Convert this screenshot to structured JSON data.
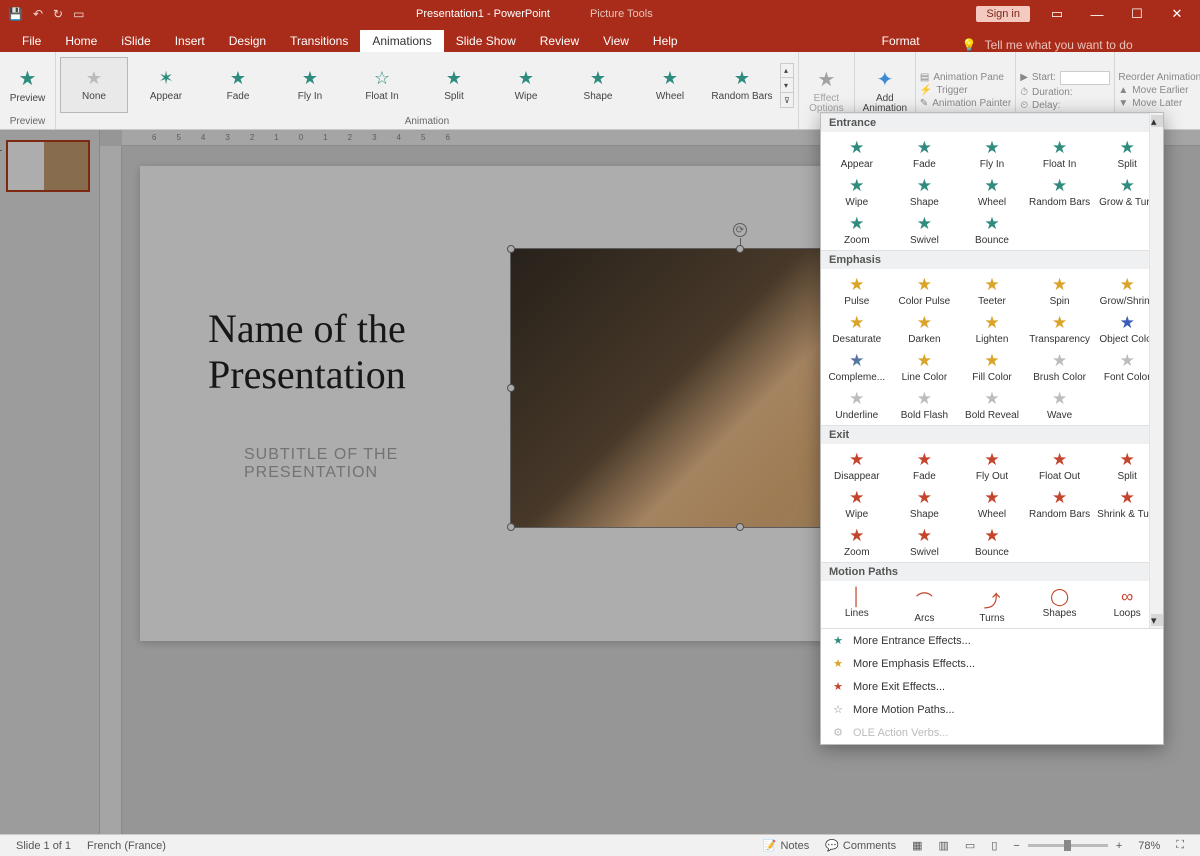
{
  "app": {
    "title": "Presentation1 - PowerPoint",
    "contextual_tool": "Picture Tools",
    "sign_in": "Sign in"
  },
  "qat": [
    "save",
    "undo",
    "redo",
    "slideshow"
  ],
  "tabs": {
    "items": [
      "File",
      "Home",
      "iSlide",
      "Insert",
      "Design",
      "Transitions",
      "Animations",
      "Slide Show",
      "Review",
      "View",
      "Help"
    ],
    "active": "Animations",
    "context": "Format",
    "tellme": "Tell me what you want to do"
  },
  "ribbon": {
    "preview": {
      "label": "Preview",
      "group": "Preview"
    },
    "animation_group": "Animation",
    "gallery": [
      "None",
      "Appear",
      "Fade",
      "Fly In",
      "Float In",
      "Split",
      "Wipe",
      "Shape",
      "Wheel",
      "Random Bars"
    ],
    "effect_options": "Effect Options",
    "add_animation": "Add Animation",
    "advanced": {
      "pane": "Animation Pane",
      "trigger": "Trigger",
      "painter": "Animation Painter"
    },
    "timing": {
      "start": "Start:",
      "duration": "Duration:",
      "delay": "Delay:"
    },
    "reorder": {
      "label": "Reorder Animation",
      "earlier": "Move Earlier",
      "later": "Move Later"
    }
  },
  "slide": {
    "title": "Name of the\nPresentation",
    "subtitle": "SUBTITLE OF THE PRESENTATION"
  },
  "dropdown": {
    "sections": {
      "entrance": {
        "label": "Entrance",
        "items": [
          "Appear",
          "Fade",
          "Fly In",
          "Float In",
          "Split",
          "Wipe",
          "Shape",
          "Wheel",
          "Random Bars",
          "Grow & Turn",
          "Zoom",
          "Swivel",
          "Bounce"
        ]
      },
      "emphasis": {
        "label": "Emphasis",
        "items": [
          "Pulse",
          "Color Pulse",
          "Teeter",
          "Spin",
          "Grow/Shrink",
          "Desaturate",
          "Darken",
          "Lighten",
          "Transparency",
          "Object Color",
          "Compleme...",
          "Line Color",
          "Fill Color",
          "Brush Color",
          "Font Color",
          "Underline",
          "Bold Flash",
          "Bold Reveal",
          "Wave"
        ]
      },
      "exit": {
        "label": "Exit",
        "items": [
          "Disappear",
          "Fade",
          "Fly Out",
          "Float Out",
          "Split",
          "Wipe",
          "Shape",
          "Wheel",
          "Random Bars",
          "Shrink & Tu...",
          "Zoom",
          "Swivel",
          "Bounce"
        ]
      },
      "motion": {
        "label": "Motion Paths",
        "items": [
          "Lines",
          "Arcs",
          "Turns",
          "Shapes",
          "Loops"
        ]
      }
    },
    "footer": {
      "entrance": "More Entrance Effects...",
      "emphasis": "More Emphasis Effects...",
      "exit": "More Exit Effects...",
      "motion": "More Motion Paths...",
      "ole": "OLE Action Verbs..."
    }
  },
  "status": {
    "slide_info": "Slide 1 of 1",
    "language": "French (France)",
    "notes": "Notes",
    "comments": "Comments",
    "zoom": "78%"
  },
  "thumb": {
    "num": "1"
  }
}
